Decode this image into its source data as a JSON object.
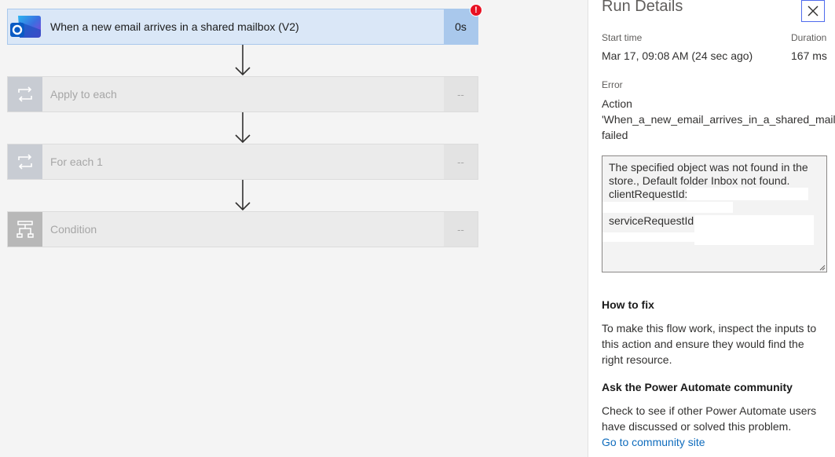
{
  "flow": {
    "steps": [
      {
        "title": "When a new email arrives in a shared mailbox (V2)",
        "duration": "0s",
        "status": "failed",
        "icon": "outlook-icon"
      },
      {
        "title": "Apply to each",
        "duration": "--",
        "status": "skipped",
        "icon": "loop-icon"
      },
      {
        "title": "For each 1",
        "duration": "--",
        "status": "skipped",
        "icon": "loop-icon"
      },
      {
        "title": "Condition",
        "duration": "--",
        "status": "skipped",
        "icon": "condition-icon"
      }
    ],
    "error_badge": "!"
  },
  "panel": {
    "title": "Run Details",
    "start_time_label": "Start time",
    "start_time_value": "Mar 17, 09:08 AM (24 sec ago)",
    "duration_label": "Duration",
    "duration_value": "167 ms",
    "error_label": "Error",
    "error_line1": "Action",
    "error_line2": "'When_a_new_email_arrives_in_a_shared_mailbox",
    "error_line3": "failed",
    "error_detail_1": "The specified object was not found in the",
    "error_detail_2": "store., Default folder Inbox not found.",
    "error_detail_3": "clientRequestId:",
    "error_detail_4": "serviceRequestId:",
    "how_to_fix_title": "How to fix",
    "how_to_fix_text": "To make this flow work, inspect the inputs to this action and ensure they would find the right resource.",
    "community_title": "Ask the Power Automate community",
    "community_text": "Check to see if other Power Automate users have discussed or solved this problem.",
    "community_link": "Go to community site"
  },
  "colors": {
    "accent": "#0f6cbd",
    "error": "#e81123",
    "trigger_bg": "#dae7f7"
  }
}
